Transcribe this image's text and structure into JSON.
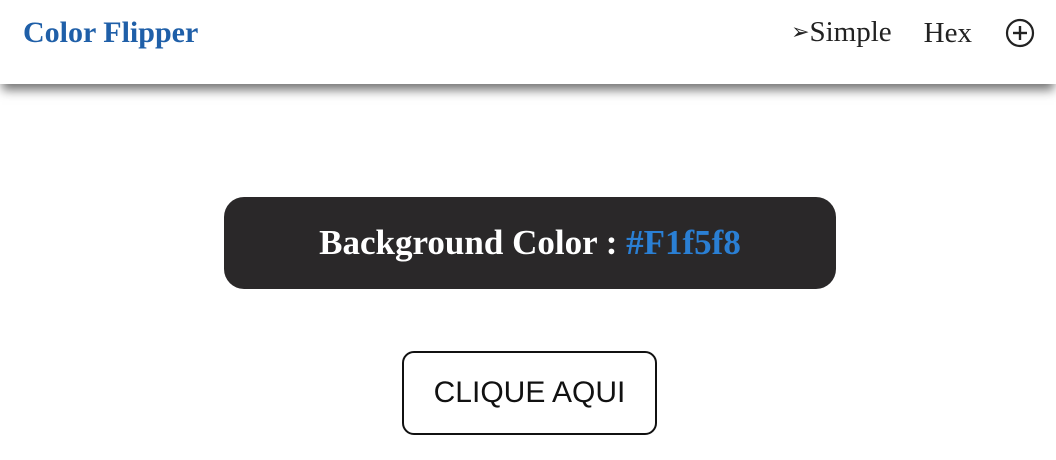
{
  "navbar": {
    "brand": "Color Flipper",
    "links": [
      {
        "label": "Simple",
        "icon": "arrow-right-icon"
      },
      {
        "label": "Hex"
      }
    ],
    "add_icon": "plus-circle-icon"
  },
  "main": {
    "color_label": "Background Color : ",
    "color_value": "#F1f5f8",
    "button_label": "CLIQUE AQUI"
  },
  "colors": {
    "brand": "#1f5fa8",
    "panel_bg": "#2a2829",
    "value_text": "#2a7fd4",
    "page_bg": "#ffffff"
  }
}
